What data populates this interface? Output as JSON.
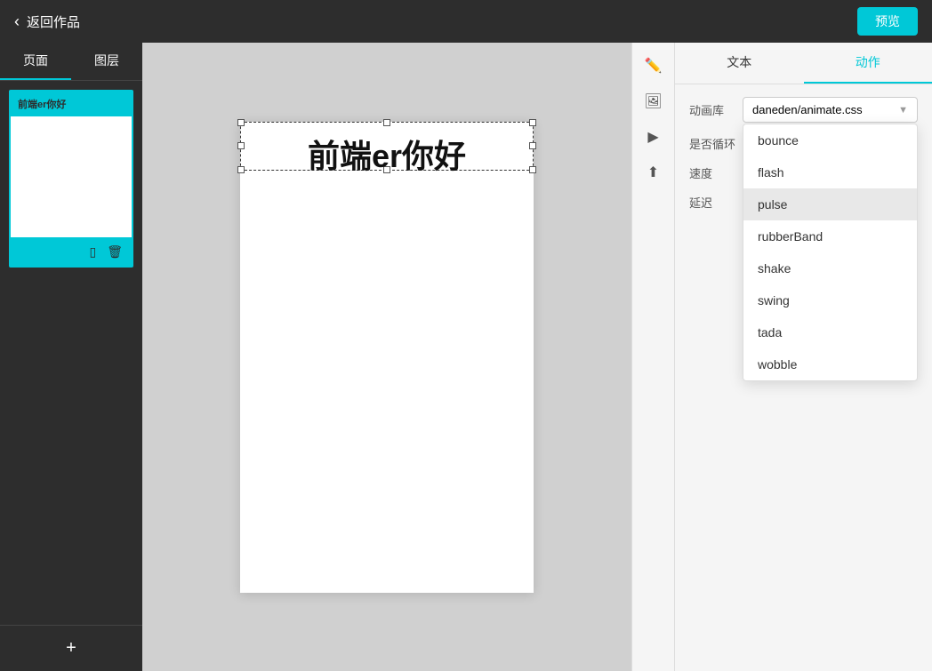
{
  "topNav": {
    "backLabel": "返回作品",
    "previewLabel": "预览"
  },
  "leftPanel": {
    "tabs": [
      "页面",
      "图层"
    ],
    "activeTab": 0,
    "thumbnailText": "前端er你好",
    "addPageIcon": "+"
  },
  "canvas": {
    "text": "前端er你好"
  },
  "rightPanel": {
    "tabs": [
      "文本",
      "动作"
    ],
    "activeTab": 1,
    "animLibLabel": "动画库",
    "animLibValue": "daneden/animate.css",
    "loopLabel": "是否循环",
    "speedLabel": "速度",
    "delayLabel": "延迟",
    "dropdownOptions": [
      {
        "label": "bounce",
        "highlighted": false
      },
      {
        "label": "flash",
        "highlighted": false
      },
      {
        "label": "pulse",
        "highlighted": true
      },
      {
        "label": "rubberBand",
        "highlighted": false
      },
      {
        "label": "shake",
        "highlighted": false
      },
      {
        "label": "swing",
        "highlighted": false
      },
      {
        "label": "tada",
        "highlighted": false
      },
      {
        "label": "wobble",
        "highlighted": false
      }
    ]
  },
  "sideToolbar": {
    "icons": [
      {
        "name": "edit-icon",
        "symbol": "✏️"
      },
      {
        "name": "image-icon",
        "symbol": "🖼"
      },
      {
        "name": "play-icon",
        "symbol": "▶"
      },
      {
        "name": "upload-icon",
        "symbol": "⬆"
      }
    ]
  }
}
